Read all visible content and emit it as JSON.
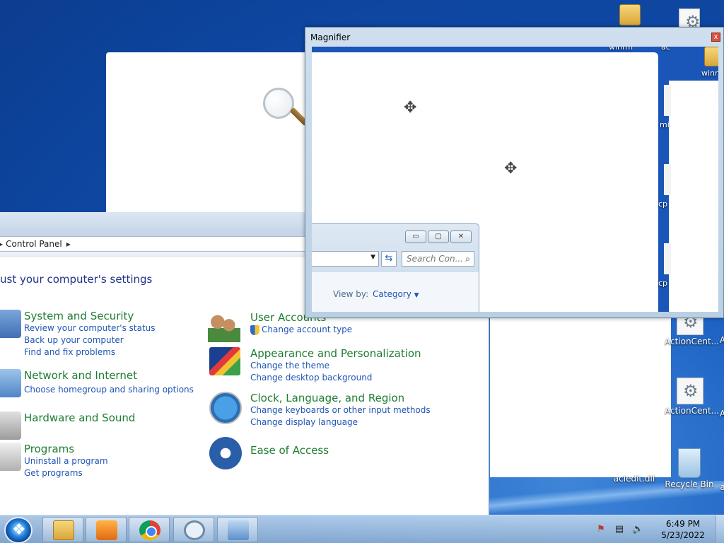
{
  "desktop": {
    "icons": [
      {
        "label": "winrm",
        "type": "folder"
      },
      {
        "label": "ac",
        "type": "file"
      },
      {
        "label": "winr",
        "type": "folder"
      },
      {
        "label": "ActionCent...",
        "type": "file"
      },
      {
        "label": "ActionCent...",
        "type": "file"
      },
      {
        "label": "acledit.dll",
        "type": "file"
      },
      {
        "label": "Recycle Bin",
        "type": "recycle"
      }
    ],
    "partial_labels": [
      "mi",
      "cp",
      "cp",
      "A",
      "A",
      "a"
    ]
  },
  "control_panel": {
    "breadcrumb": [
      "Control Panel"
    ],
    "heading": "ust your computer's settings",
    "categories_left": [
      {
        "title": "System and Security",
        "links": [
          "Review your computer's status",
          "Back up your computer",
          "Find and fix problems"
        ],
        "icon": "shield-computer-icon"
      },
      {
        "title": "Network and Internet",
        "links": [
          "Choose homegroup and sharing options"
        ],
        "icon": "network-icon"
      },
      {
        "title": "Hardware and Sound",
        "links": [],
        "icon": "printer-speaker-icon"
      },
      {
        "title": "Programs",
        "links": [
          "Uninstall a program",
          "Get programs"
        ],
        "icon": "programs-icon"
      }
    ],
    "categories_right": [
      {
        "title": "User Accounts",
        "links": [
          "Change account type"
        ],
        "icon": "users-icon"
      },
      {
        "title": "Appearance and Personalization",
        "links": [
          "Change the theme",
          "Change desktop background"
        ],
        "icon": "appearance-icon"
      },
      {
        "title": "Clock, Language, and Region",
        "links": [
          "Change keyboards or other input methods",
          "Change display language"
        ],
        "icon": "clock-globe-icon"
      },
      {
        "title": "Ease of Access",
        "links": [],
        "icon": "ease-of-access-icon"
      }
    ]
  },
  "magnifier": {
    "title": "Magnifier",
    "close": "x",
    "view": {
      "top_labels": [
        "winrm",
        "ac",
        "winr"
      ],
      "side_labels": [
        "mi",
        "cp",
        "cp"
      ],
      "search_placeholder": "Search Con...",
      "view_by_label": "View by:",
      "view_by_value": "Category",
      "window_buttons": [
        "minimize",
        "maximize",
        "close"
      ]
    }
  },
  "taskbar": {
    "pinned": [
      "windows-explorer",
      "windows-media-player",
      "google-chrome",
      "magnifier",
      "control-panel"
    ],
    "clock": {
      "time": "6:49 PM",
      "date": "5/23/2022"
    }
  }
}
